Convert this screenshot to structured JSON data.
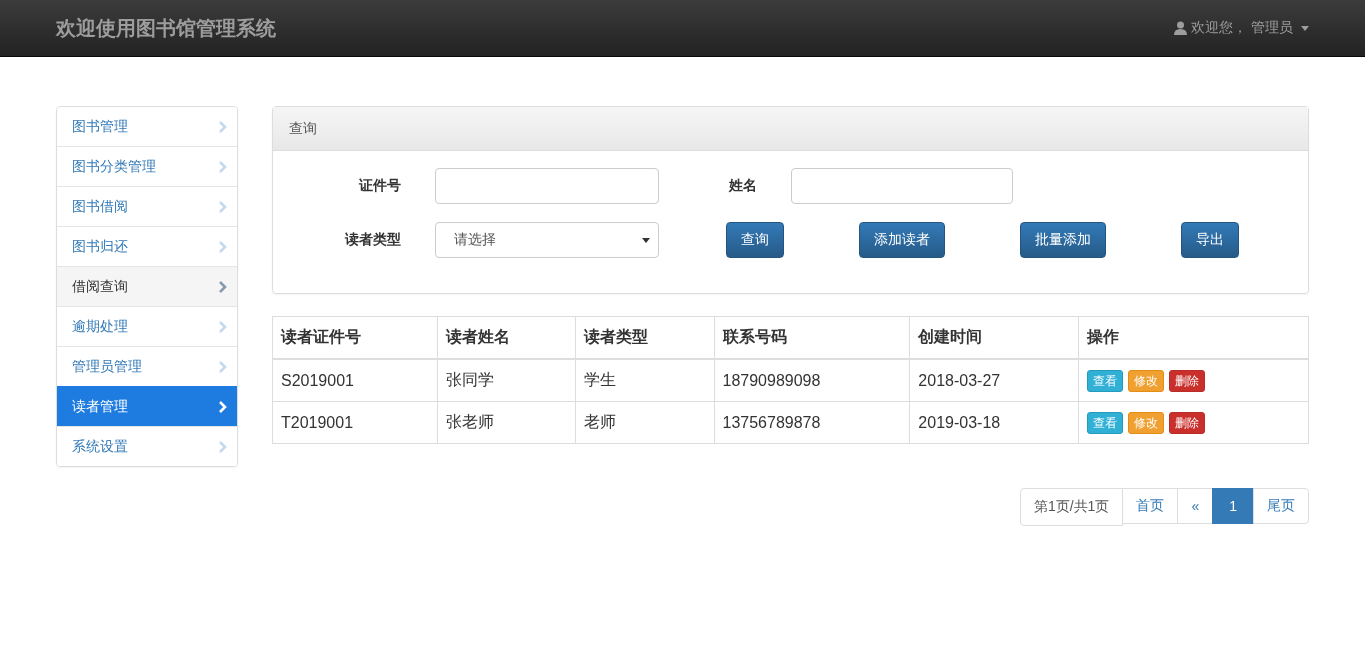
{
  "navbar": {
    "brand": "欢迎使用图书馆管理系统",
    "user_menu": {
      "label": "欢迎您， 管理员"
    }
  },
  "sidebar": {
    "items": [
      {
        "label": "图书管理",
        "selected": false,
        "highlighted": false
      },
      {
        "label": "图书分类管理",
        "selected": false,
        "highlighted": false
      },
      {
        "label": "图书借阅",
        "selected": false,
        "highlighted": false
      },
      {
        "label": "图书归还",
        "selected": false,
        "highlighted": false
      },
      {
        "label": "借阅查询",
        "selected": false,
        "highlighted": true
      },
      {
        "label": "逾期处理",
        "selected": false,
        "highlighted": false
      },
      {
        "label": "管理员管理",
        "selected": false,
        "highlighted": false
      },
      {
        "label": "读者管理",
        "selected": true,
        "highlighted": false
      },
      {
        "label": "系统设置",
        "selected": false,
        "highlighted": false
      }
    ]
  },
  "query_panel": {
    "title": "查询",
    "fields": [
      {
        "label": "证件号",
        "kind": "text"
      },
      {
        "label": "姓名",
        "kind": "text"
      },
      {
        "label": "读者类型",
        "kind": "select",
        "value": "请选择"
      }
    ],
    "buttons": [
      "查询",
      "添加读者",
      "批量添加",
      "导出"
    ]
  },
  "table": {
    "columns": [
      "读者证件号",
      "读者姓名",
      "读者类型",
      "联系号码",
      "创建时间",
      "操作"
    ],
    "rows": [
      {
        "cells": [
          "S2019001",
          "张同学",
          "学生",
          "18790989098",
          "2018-03-27"
        ],
        "actions": [
          {
            "label": "查看",
            "kind": "view"
          },
          {
            "label": "修改",
            "kind": "edit"
          },
          {
            "label": "删除",
            "kind": "delete"
          }
        ]
      },
      {
        "cells": [
          "T2019001",
          "张老师",
          "老师",
          "13756789878",
          "2019-03-18"
        ],
        "actions": [
          {
            "label": "查看",
            "kind": "view"
          },
          {
            "label": "修改",
            "kind": "edit"
          },
          {
            "label": "删除",
            "kind": "delete"
          }
        ]
      }
    ]
  },
  "pagination": [
    {
      "label": "第1页/共1页",
      "kind": "info",
      "selected": false
    },
    {
      "label": "首页",
      "kind": "link",
      "selected": false
    },
    {
      "label": "«",
      "kind": "link",
      "selected": false
    },
    {
      "label": "1",
      "kind": "link",
      "selected": true
    },
    {
      "label": "尾页",
      "kind": "link",
      "selected": false
    }
  ]
}
